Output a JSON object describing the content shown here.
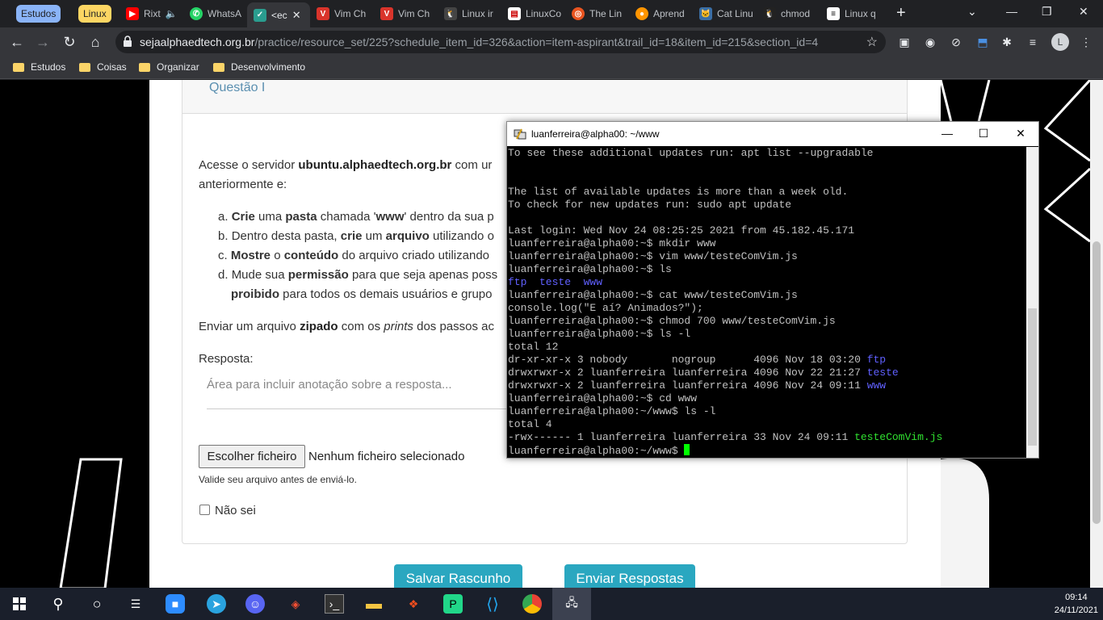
{
  "browser": {
    "tab_groups": [
      {
        "label": "Estudos",
        "color": "#8ab4f8"
      },
      {
        "label": "Linux",
        "color": "#fdd663"
      }
    ],
    "tabs": [
      {
        "label": "Rixt",
        "icon": "youtube-icon"
      },
      {
        "label": "WhatsA",
        "icon": "whatsapp-icon"
      },
      {
        "label": "<ec",
        "icon": "alphaedtech-icon",
        "active": true
      },
      {
        "label": "Vim Ch",
        "icon": "vim-icon"
      },
      {
        "label": "Vim Ch",
        "icon": "vim-icon"
      },
      {
        "label": "Linux ir",
        "icon": "linux-icon"
      },
      {
        "label": "LinuxCo",
        "icon": "page-icon"
      },
      {
        "label": "The Lin",
        "icon": "ubuntu-icon"
      },
      {
        "label": "Aprend",
        "icon": "firefox-icon"
      },
      {
        "label": "Cat Linu",
        "icon": "cat-icon"
      },
      {
        "label": "chmod",
        "icon": "linux-icon"
      },
      {
        "label": "Linux q",
        "icon": "page-icon"
      }
    ],
    "url_domain": "sejaalphaedtech.org.br",
    "url_path": "/practice/resource_set/225?schedule_item_id=326&action=item-aspirant&trail_id=18&item_id=215&section_id=4",
    "profile_initial": "L",
    "bookmarks": [
      "Estudos",
      "Coisas",
      "Organizar",
      "Desenvolvimento"
    ]
  },
  "page": {
    "question_title": "Questão I",
    "intro_line1_a": "Acesse o servidor ",
    "intro_line1_b": "ubuntu.alphaedtech.org.br",
    "intro_line1_c": " com ur",
    "intro_line2": "anteriormente e:",
    "items": [
      {
        "marker": "a.",
        "parts": [
          "Crie",
          " uma ",
          "pasta",
          " chamada '",
          "www",
          "' dentro da sua p"
        ]
      },
      {
        "marker": "b.",
        "parts": [
          "Dentro desta pasta, ",
          "crie",
          " um ",
          "arquivo",
          " utilizando o"
        ]
      },
      {
        "marker": "c.",
        "parts": [
          "Mostre",
          " o ",
          "conteúdo",
          " do arquivo criado utilizando"
        ]
      },
      {
        "marker": "d.",
        "parts": [
          "Mude sua ",
          "permissão",
          " para que seja apenas poss"
        ]
      }
    ],
    "item_d_line2_a": "proibido",
    "item_d_line2_b": " para todos os demais usuários e grupo",
    "send_a": "Enviar um arquivo ",
    "send_b": "zipado",
    "send_c": " com os ",
    "send_d": "prints",
    "send_e": " dos passos ac",
    "answer_label": "Resposta:",
    "answer_placeholder": "Área para incluir anotação sobre a resposta...",
    "file_button": "Escolher ficheiro",
    "file_status": "Nenhum ficheiro selecionado",
    "file_hint": "Valide seu arquivo antes de enviá-lo.",
    "dont_know": "Não sei",
    "save_draft": "Salvar Rascunho",
    "send_answers": "Enviar Respostas"
  },
  "terminal": {
    "title": "luanferreira@alpha00: ~/www",
    "lines": [
      [
        [
          "To see these additional updates run: apt list --upgradable",
          ""
        ]
      ],
      [
        [
          "",
          ""
        ]
      ],
      [
        [
          "",
          ""
        ]
      ],
      [
        [
          "The list of available updates is more than a week old.",
          ""
        ]
      ],
      [
        [
          "To check for new updates run: sudo apt update",
          ""
        ]
      ],
      [
        [
          "",
          ""
        ]
      ],
      [
        [
          "Last login: Wed Nov 24 08:25:25 2021 from 45.182.45.171",
          ""
        ]
      ],
      [
        [
          "luanferreira@alpha00:~$ mkdir www",
          ""
        ]
      ],
      [
        [
          "luanferreira@alpha00:~$ vim www/testeComVim.js",
          ""
        ]
      ],
      [
        [
          "luanferreira@alpha00:~$ ls",
          ""
        ]
      ],
      [
        [
          "ftp  teste  www",
          "blue"
        ]
      ],
      [
        [
          "luanferreira@alpha00:~$ cat www/testeComVim.js",
          ""
        ]
      ],
      [
        [
          "console.log(\"E aí? Animados?\");",
          ""
        ]
      ],
      [
        [
          "luanferreira@alpha00:~$ chmod 700 www/testeComVim.js",
          ""
        ]
      ],
      [
        [
          "luanferreira@alpha00:~$ ls -l",
          ""
        ]
      ],
      [
        [
          "total 12",
          ""
        ]
      ],
      [
        [
          "dr-xr-xr-x 3 nobody       nogroup      4096 Nov 18 03:20 ",
          ""
        ],
        [
          "ftp",
          "blue"
        ]
      ],
      [
        [
          "drwxrwxr-x 2 luanferreira luanferreira 4096 Nov 22 21:27 ",
          ""
        ],
        [
          "teste",
          "blue"
        ]
      ],
      [
        [
          "drwxrwxr-x 2 luanferreira luanferreira 4096 Nov 24 09:11 ",
          ""
        ],
        [
          "www",
          "blue"
        ]
      ],
      [
        [
          "luanferreira@alpha00:~$ cd www",
          ""
        ]
      ],
      [
        [
          "luanferreira@alpha00:~/www$ ls -l",
          ""
        ]
      ],
      [
        [
          "total 4",
          ""
        ]
      ],
      [
        [
          "-rwx------ 1 luanferreira luanferreira 33 Nov 24 09:11 ",
          ""
        ],
        [
          "testeComVim.js",
          "green"
        ]
      ],
      [
        [
          "luanferreira@alpha00:~/www$ ",
          ""
        ],
        [
          "",
          "cursor"
        ]
      ]
    ]
  },
  "taskbar": {
    "time": "09:14",
    "date": "24/11/2021",
    "icons": [
      "windows-start-icon",
      "search-icon",
      "cortana-icon",
      "task-view-icon",
      "zoom-icon",
      "telegram-icon",
      "discord-icon",
      "git-icon",
      "terminal-icon",
      "file-explorer-icon",
      "figma-icon",
      "pycharm-icon",
      "vscode-icon",
      "chrome-icon",
      "putty-icon"
    ]
  }
}
